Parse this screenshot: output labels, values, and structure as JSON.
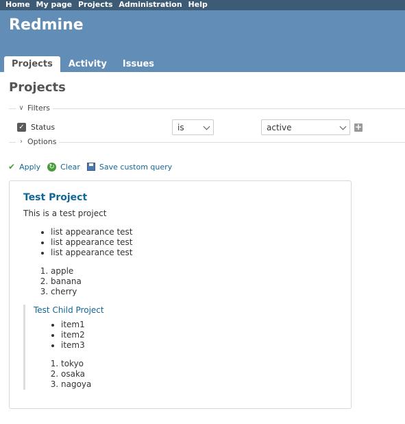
{
  "top_menu": {
    "items": [
      "Home",
      "My page",
      "Projects",
      "Administration",
      "Help"
    ]
  },
  "header": {
    "title": "Redmine",
    "tabs": [
      {
        "label": "Projects",
        "selected": true
      },
      {
        "label": "Activity",
        "selected": false
      },
      {
        "label": "Issues",
        "selected": false
      }
    ]
  },
  "page": {
    "title": "Projects"
  },
  "filters": {
    "legend": "Filters",
    "status_label": "Status",
    "status_checked": true,
    "operator": "is",
    "value": "active",
    "add_symbol": "+"
  },
  "options": {
    "legend": "Options"
  },
  "actions": {
    "apply": "Apply",
    "clear": "Clear",
    "save": "Save custom query"
  },
  "project": {
    "title": "Test Project",
    "description": "This is a test project",
    "bullets": [
      "list appearance test",
      "list appearance test",
      "list appearance test"
    ],
    "ordered": [
      "apple",
      "banana",
      "cherry"
    ],
    "child": {
      "title": "Test Child Project",
      "bullets": [
        "item1",
        "item2",
        "item3"
      ],
      "ordered": [
        "tokyo",
        "osaka",
        "nagoya"
      ]
    }
  },
  "colors": {
    "top_menu_bg": "#3e5b76",
    "header_bg": "#628db6",
    "link": "#169",
    "accent_green": "#4a9b3d"
  }
}
